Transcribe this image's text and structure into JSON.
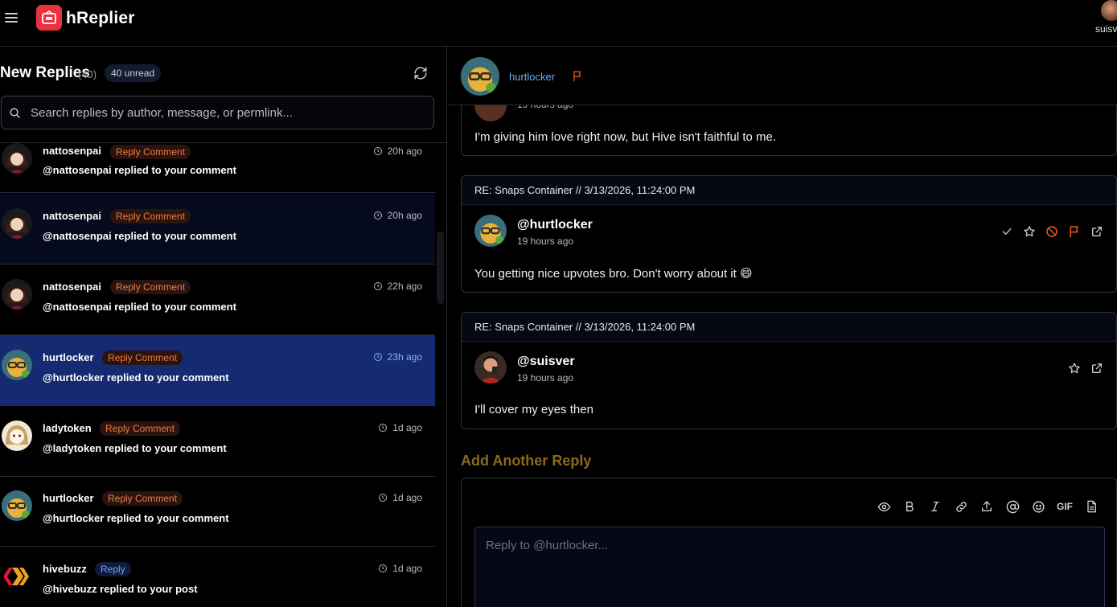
{
  "app": {
    "name": "hReplier",
    "user": "suisver"
  },
  "colors": {
    "accent_blue": "#6aa8ff",
    "selected_row": "#152a70",
    "tag_orange": "#f07a40",
    "add_reply_gold": "#8a6a1c",
    "logo_red": "#e8333f"
  },
  "sidebar": {
    "title": "New Replies",
    "count": "(40)",
    "unread": "40 unread",
    "search_placeholder": "Search replies by author, message, or permlink...",
    "items": [
      {
        "author": "nattosenpai",
        "tag": "Reply Comment",
        "time": "20h ago",
        "message": "@nattosenpai replied to your comment"
      },
      {
        "author": "nattosenpai",
        "tag": "Reply Comment",
        "time": "20h ago",
        "message": "@nattosenpai replied to your comment"
      },
      {
        "author": "nattosenpai",
        "tag": "Reply Comment",
        "time": "22h ago",
        "message": "@nattosenpai replied to your comment"
      },
      {
        "author": "hurtlocker",
        "tag": "Reply Comment",
        "time": "23h ago",
        "message": "@hurtlocker replied to your comment"
      },
      {
        "author": "ladytoken",
        "tag": "Reply Comment",
        "time": "1d ago",
        "message": "@ladytoken replied to your comment"
      },
      {
        "author": "hurtlocker",
        "tag": "Reply Comment",
        "time": "1d ago",
        "message": "@hurtlocker replied to your comment"
      },
      {
        "author": "hivebuzz",
        "tag": "Reply",
        "time": "1d ago",
        "message": "@hivebuzz replied to your post"
      }
    ]
  },
  "thread": {
    "author": "hurtlocker",
    "partial_card": {
      "time": "19 hours ago",
      "body": "I'm giving him love right now, but Hive isn't faithful to me."
    },
    "cards": [
      {
        "header": "RE: Snaps Container // 3/13/2026, 11:24:00 PM",
        "handle": "@hurtlocker",
        "time": "19 hours ago",
        "body": "You getting nice upvotes bro. Don't worry about it 😄"
      },
      {
        "header": "RE: Snaps Container // 3/13/2026, 11:24:00 PM",
        "handle": "@suisver",
        "time": "19 hours ago",
        "body": "I'll cover my eyes then"
      }
    ],
    "add_reply_title": "Add Another Reply",
    "reply_placeholder": "Reply to @hurtlocker...",
    "toolbar": {
      "gif_label": "GIF"
    }
  }
}
